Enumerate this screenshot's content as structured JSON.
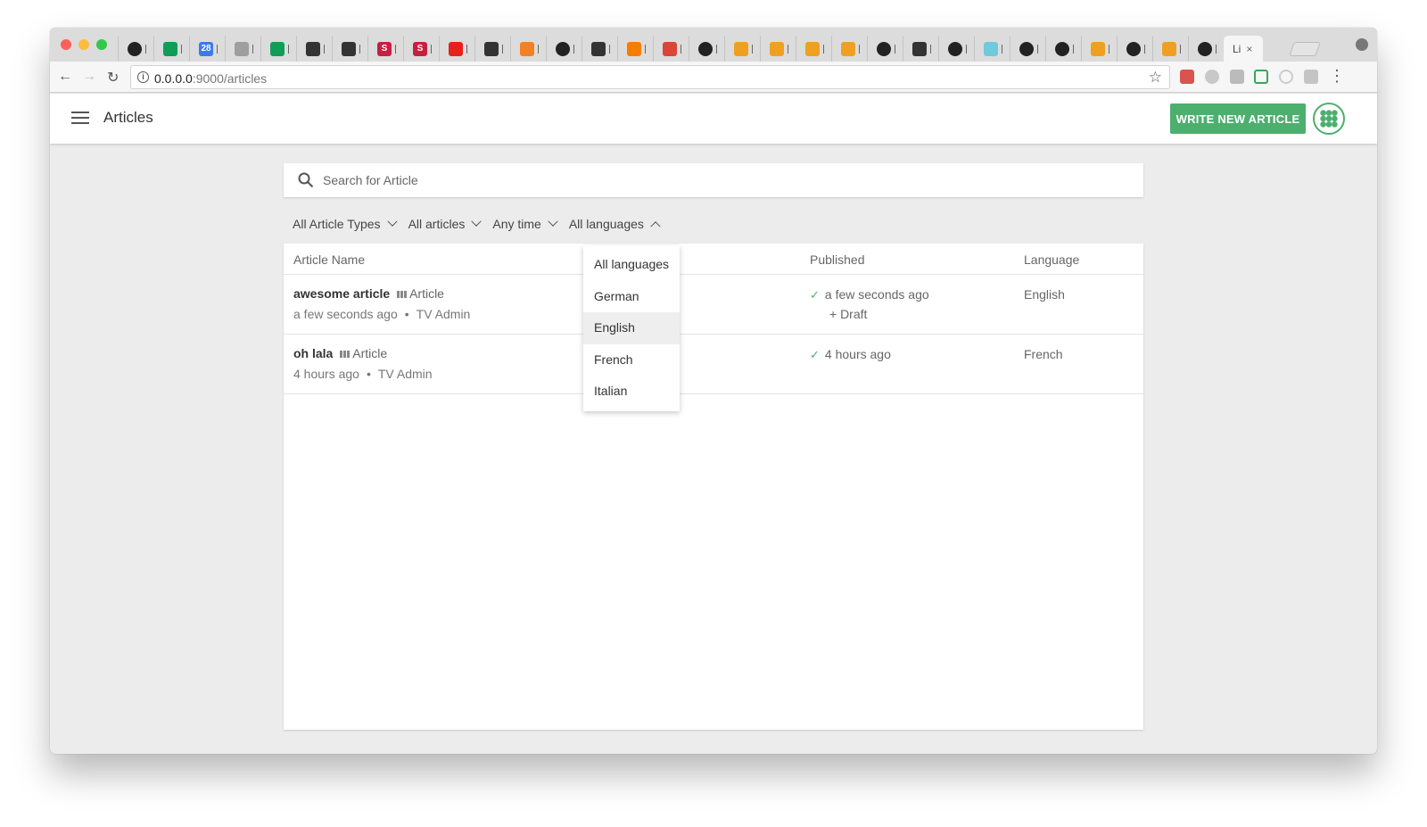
{
  "browser": {
    "tabs": [
      {
        "icon": "github-icon"
      },
      {
        "icon": "sheets-icon"
      },
      {
        "icon": "calendar-icon",
        "text": "28"
      },
      {
        "icon": "doc-icon"
      },
      {
        "icon": "sheets-icon"
      },
      {
        "icon": "site-icon"
      },
      {
        "icon": "site-icon"
      },
      {
        "icon": "s-icon",
        "text": "S"
      },
      {
        "icon": "s-icon",
        "text": "S"
      },
      {
        "icon": "youtube-icon"
      },
      {
        "icon": "site-icon"
      },
      {
        "icon": "stack-icon"
      },
      {
        "icon": "github-icon"
      },
      {
        "icon": "site-icon"
      },
      {
        "icon": "blogger-icon"
      },
      {
        "icon": "chrome-icon"
      },
      {
        "icon": "github-icon"
      },
      {
        "icon": "book-icon"
      },
      {
        "icon": "book-icon"
      },
      {
        "icon": "circle-icon"
      },
      {
        "icon": "book-icon"
      },
      {
        "icon": "github-icon"
      },
      {
        "icon": "site-icon"
      },
      {
        "icon": "github-icon"
      },
      {
        "icon": "slack-icon"
      },
      {
        "icon": "github-icon"
      },
      {
        "icon": "github-icon"
      },
      {
        "icon": "book-icon"
      },
      {
        "icon": "github-icon"
      },
      {
        "icon": "book-icon"
      },
      {
        "icon": "github-icon"
      }
    ],
    "active_tab": {
      "label": "Li",
      "close": "×"
    },
    "url_host": "0.0.0.0",
    "url_rest": ":9000/articles"
  },
  "appbar": {
    "title": "Articles",
    "write_button": "WRITE NEW ARTICLE"
  },
  "search": {
    "placeholder": "Search for Article"
  },
  "filters": {
    "types": "All Article Types",
    "articles": "All articles",
    "time": "Any time",
    "languages": "All languages"
  },
  "table": {
    "headers": {
      "name": "Article Name",
      "published": "Published",
      "language": "Language"
    },
    "rows": [
      {
        "name": "awesome article",
        "type": "Article",
        "time": "a few seconds ago",
        "author": "TV Admin",
        "published": "a few seconds ago",
        "draft": "+ Draft",
        "language": "English"
      },
      {
        "name": "oh lala",
        "type": "Article",
        "time": "4 hours ago",
        "author": "TV Admin",
        "published": "4 hours ago",
        "draft": "",
        "language": "French"
      }
    ]
  },
  "language_dropdown": {
    "options": [
      "All languages",
      "German",
      "English",
      "French",
      "Italian"
    ],
    "highlighted": "English"
  },
  "colors": {
    "accent": "#4caf6e",
    "background": "#ececec"
  }
}
